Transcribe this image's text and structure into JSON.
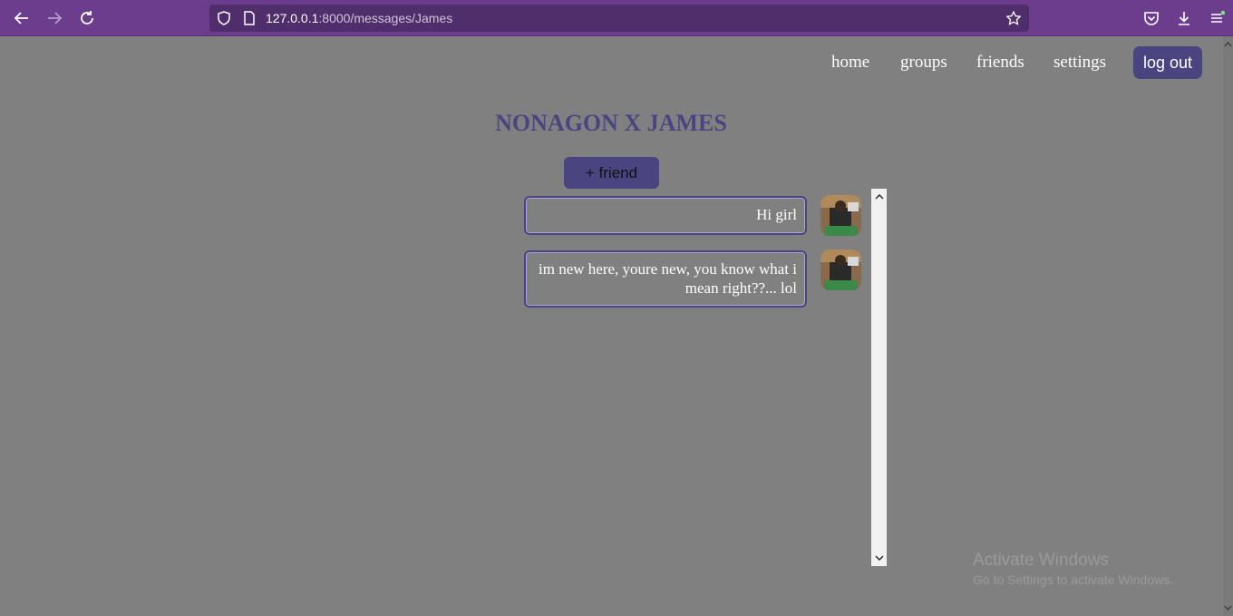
{
  "browser": {
    "url_host": "127.0.0.1",
    "url_path": ":8000/messages/James",
    "icons": [
      "back-arrow-icon",
      "forward-arrow-icon",
      "reload-icon",
      "shield-icon",
      "page-icon",
      "bookmark-star-icon",
      "pocket-icon",
      "download-icon",
      "menu-icon"
    ],
    "accent": "#6b3d8c"
  },
  "nav": {
    "home": "home",
    "groups": "groups",
    "friends": "friends",
    "settings": "settings",
    "logout": "log out"
  },
  "page": {
    "title": "NONAGON X JAMES",
    "add_friend": "+ friend"
  },
  "messages": [
    {
      "text": "Hi girl"
    },
    {
      "text": "im new here, youre new, you know what i mean right??... lol"
    }
  ],
  "watermark": {
    "title": "Activate Windows",
    "subtitle": "Go to Settings to activate Windows."
  },
  "colors": {
    "primary": "#4a4580",
    "background": "#808080"
  }
}
